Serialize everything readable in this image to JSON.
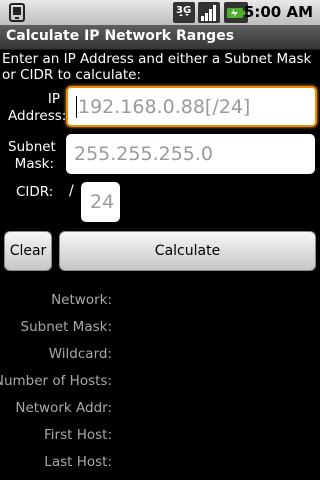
{
  "status_bar": {
    "time": "5:00 AM",
    "network_badge": "3G",
    "icons": [
      "notification-icon",
      "3g-data-icon",
      "signal-strength-icon",
      "battery-charging-icon"
    ]
  },
  "title_bar": {
    "title": "Calculate IP Network Ranges"
  },
  "form": {
    "instructions": "Enter an IP Address and either a Subnet Mask or CIDR to calculate:",
    "ip_label_line1": "IP",
    "ip_label_line2": "Address:",
    "ip_placeholder": "192.168.0.88[/24]",
    "ip_value": "",
    "subnet_label_line1": "Subnet",
    "subnet_label_line2": "Mask:",
    "subnet_placeholder": "255.255.255.0",
    "subnet_value": "",
    "cidr_label": "CIDR:",
    "cidr_separator": "/",
    "cidr_placeholder": "24",
    "cidr_value": ""
  },
  "buttons": {
    "clear": "Clear",
    "calculate": "Calculate"
  },
  "results": [
    {
      "label": "Network:",
      "value": ""
    },
    {
      "label": "Subnet Mask:",
      "value": ""
    },
    {
      "label": "Wildcard:",
      "value": ""
    },
    {
      "label": "Number of Hosts:",
      "value": ""
    },
    {
      "label": "Network Addr:",
      "value": ""
    },
    {
      "label": "First Host:",
      "value": ""
    },
    {
      "label": "Last Host:",
      "value": ""
    }
  ],
  "colors": {
    "focus_border": "#f08a00",
    "background": "#000000",
    "result_label": "#a8a8a8"
  }
}
